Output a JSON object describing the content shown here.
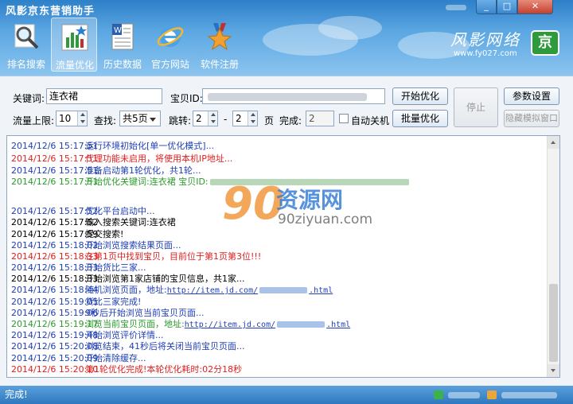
{
  "app": {
    "title": "风影京东营销助手"
  },
  "toolbar": {
    "items": [
      {
        "label": "排名搜索",
        "icon": "magnifier-icon"
      },
      {
        "label": "流量优化",
        "icon": "bar-chart-icon"
      },
      {
        "label": "历史数据",
        "icon": "document-icon"
      },
      {
        "label": "官方网站",
        "icon": "ie-browser-icon"
      },
      {
        "label": "软件注册",
        "icon": "medal-star-icon"
      }
    ],
    "active": "流量优化"
  },
  "brand": {
    "name": "风影网络",
    "url": "www.fy027.com",
    "logo": "京"
  },
  "form": {
    "keyword_label": "关键词:",
    "keyword_value": "连衣裙",
    "baobei_label": "宝贝ID:",
    "traffic_label": "流量上限:",
    "traffic_value": "10",
    "find_label": "查找:",
    "find_value": "共5页",
    "jump_label": "跳转:",
    "jump_from": "2",
    "jump_dash": "-",
    "jump_to": "2",
    "jump_unit": "页",
    "done_label": "完成:",
    "done_value": "2",
    "auto_shutdown_label": "自动关机"
  },
  "buttons": {
    "start": "开始优化",
    "batch": "批量优化",
    "stop": "停止",
    "settings": "参数设置",
    "hide_browser": "隐藏模拟窗口"
  },
  "log": [
    {
      "ts": "2014/12/6 15:17:51",
      "text": "运行环境初始化[单一优化模式]...",
      "color": "#1f3fb5"
    },
    {
      "ts": "2014/12/6 15:17:51",
      "text": "代理功能未启用，将使用本机IP地址...",
      "color": "#e02020"
    },
    {
      "ts": "2014/12/6 15:17:51",
      "text": "准备启动第1轮优化，共1轮...",
      "color": "#1f3fb5"
    },
    {
      "ts": "2014/12/6 15:17:51",
      "text": "开始优化关键词:连衣裙 宝贝ID:",
      "color": "#2a9a2a"
    },
    {
      "ts": "2014/12/6 15:17:52",
      "text": "优化平台启动中...",
      "color": "#1f3fb5"
    },
    {
      "ts": "2014/12/6 15:17:52",
      "text": "输入搜索关键词:连衣裙",
      "color": "#000000"
    },
    {
      "ts": "2014/12/6 15:17:59",
      "text": "提交搜索!",
      "color": "#000000"
    },
    {
      "ts": "2014/12/6 15:18:02",
      "text": "开始浏览搜索结果页面...",
      "color": "#1f3fb5"
    },
    {
      "ts": "2014/12/6 15:18:33",
      "text": "在第1页中找到宝贝，目前位于第1页第3位!!!",
      "color": "#e02020"
    },
    {
      "ts": "2014/12/6 15:18:33",
      "text": "开始货比三家...",
      "color": "#1f3fb5"
    },
    {
      "ts": "2014/12/6 15:18:33",
      "text": "开始浏览第1家店铺的宝贝信息，共1家...",
      "color": "#000000"
    },
    {
      "ts": "2014/12/6 15:18:44",
      "text": "随机浏览页面，地址:",
      "color": "#1f3fb5",
      "link_pre": "http://item.jd.com/",
      "link_post": ".html"
    },
    {
      "ts": "2014/12/6 15:19:05",
      "text": "货比三家完成!",
      "color": "#1f3fb5"
    },
    {
      "ts": "2014/12/6 15:19:06",
      "text": "9秒后开始浏览当前宝贝页面...",
      "color": "#1f3fb5"
    },
    {
      "ts": "2014/12/6 15:19:17",
      "text": "浏览当前宝贝页面，地址:",
      "color": "#2a9a2a",
      "link_pre": "http://item.jd.com/",
      "link_post": ".html"
    },
    {
      "ts": "2014/12/6 15:19:48",
      "text": "开始浏览评价详情...",
      "color": "#1f3fb5"
    },
    {
      "ts": "2014/12/6 15:20:08",
      "text": "浏览结束，41秒后将关闭当前宝贝页面...",
      "color": "#1f3fb5"
    },
    {
      "ts": "2014/12/6 15:20:09",
      "text": "开始清除缓存...",
      "color": "#1f3fb5"
    },
    {
      "ts": "2014/12/6 15:20:10",
      "text": "第1轮优化完成!本轮优化耗时:02分18秒",
      "color": "#e02020"
    }
  ],
  "watermark": {
    "big": "90",
    "cn": "资源网",
    "en": "90ziyuan.com"
  },
  "status": {
    "text": "完成!"
  }
}
